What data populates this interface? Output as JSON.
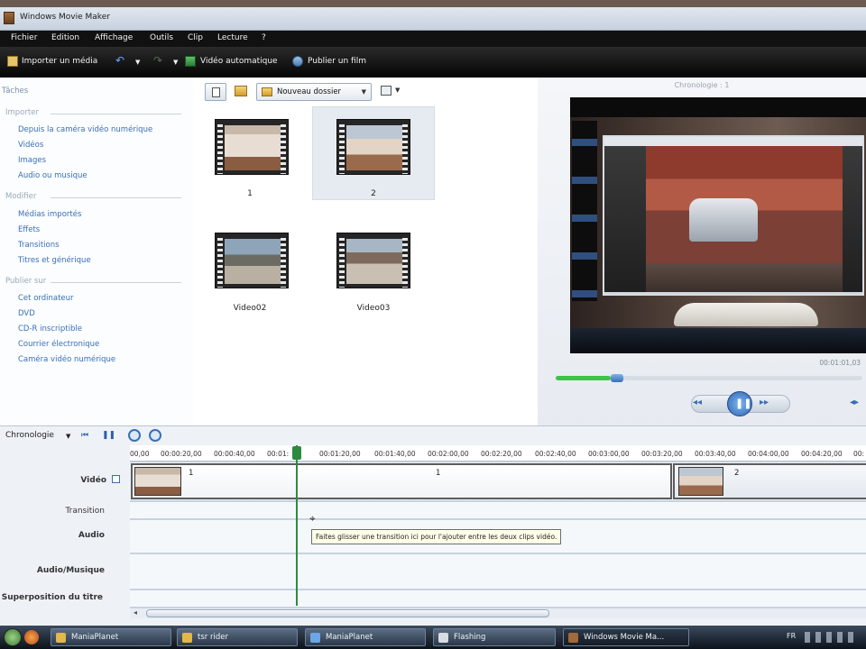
{
  "window": {
    "title": "Windows Movie Maker"
  },
  "menu": [
    "Fichier",
    "Edition",
    "Affichage",
    "Outils",
    "Clip",
    "Lecture",
    "?"
  ],
  "toolbar": {
    "import": "Importer un média",
    "auto_movie": "Vidéo automatique",
    "publish": "Publier un film"
  },
  "tasks": {
    "heading": "Tâches",
    "import": {
      "title": "Importer",
      "items": [
        "Depuis la caméra vidéo numérique",
        "Vidéos",
        "Images",
        "Audio ou musique"
      ]
    },
    "edit": {
      "title": "Modifier",
      "items": [
        "Médias importés",
        "Effets",
        "Transitions",
        "Titres et générique"
      ]
    },
    "publish": {
      "title": "Publier sur",
      "items": [
        "Cet ordinateur",
        "DVD",
        "CD-R inscriptible",
        "Courrier électronique",
        "Caméra vidéo numérique"
      ]
    }
  },
  "collection": {
    "new_folder": "Nouveau dossier",
    "items": [
      {
        "label": "1"
      },
      {
        "label": "2"
      },
      {
        "label": "Video02"
      },
      {
        "label": "Video03"
      }
    ]
  },
  "preview": {
    "title": "Chronologie : 1",
    "time": "00:01:01,03",
    "progress": 0.18
  },
  "timeline": {
    "mode": "Chronologie",
    "ruler": [
      "00,00",
      "00:00:20,00",
      "00:00:40,00",
      "00:01:",
      "00:01:20,00",
      "00:01:40,00",
      "00:02:00,00",
      "00:02:20,00",
      "00:02:40,00",
      "00:03:00,00",
      "00:03:20,00",
      "00:03:40,00",
      "00:04:00,00",
      "00:04:20,00",
      "00:"
    ],
    "tracks": {
      "video": "Vidéo",
      "transition": "Transition",
      "audio": "Audio",
      "music": "Audio/Musique",
      "title_overlay": "Superposition du titre"
    },
    "clips": [
      {
        "label": "1"
      },
      {
        "label": "1"
      },
      {
        "label": "2"
      }
    ],
    "tooltip": "Faites glisser une transition ici pour l'ajouter entre les deux clips vidéo."
  },
  "taskbar": {
    "items": [
      "ManiaPlanet",
      "tsr rider",
      "ManiaPlanet",
      "Flashing",
      "Windows Movie Ma..."
    ],
    "lang": "FR"
  },
  "colors": {
    "accent": "#3a6fb5",
    "playhead": "#2e8b3e",
    "progress": "#3fc24a"
  }
}
